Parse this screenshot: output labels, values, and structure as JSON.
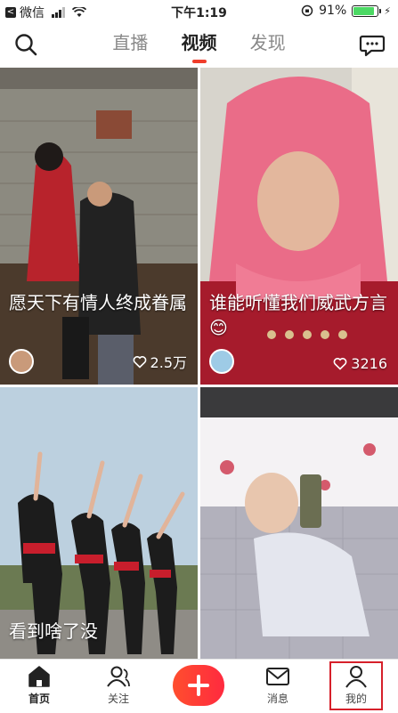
{
  "status_bar": {
    "back_glyph": "<",
    "carrier": "微信",
    "time": "下午1:19",
    "battery_percent": "91%",
    "battery_level": 0.91,
    "icons": [
      "signal-icon",
      "wifi-icon",
      "orientation-lock-icon",
      "battery-icon",
      "charging-icon"
    ]
  },
  "top_nav": {
    "tabs": [
      {
        "label": "直播",
        "active": false
      },
      {
        "label": "视频",
        "active": true
      },
      {
        "label": "发现",
        "active": false
      }
    ],
    "icons": [
      "search-icon",
      "chat-icon"
    ],
    "accent_color": "#f03e2c"
  },
  "feed": {
    "cards": [
      {
        "caption": "愿天下有情人终成眷属",
        "likes": "2.5万",
        "icons": [
          "avatar",
          "heart-icon"
        ]
      },
      {
        "caption": "谁能听懂我们威武方言😊",
        "likes": "3216",
        "icons": [
          "avatar",
          "heart-icon"
        ]
      },
      {
        "caption": "看到啥了没"
      },
      {
        "caption": ""
      }
    ]
  },
  "bottom_nav": {
    "items": [
      {
        "label": "首页",
        "icon": "home-icon",
        "active": true
      },
      {
        "label": "关注",
        "icon": "follow-icon",
        "active": false
      },
      {
        "label": "",
        "icon": "plus-icon",
        "active": false
      },
      {
        "label": "消息",
        "icon": "message-icon",
        "active": false
      },
      {
        "label": "我的",
        "icon": "profile-icon",
        "active": false
      }
    ],
    "plus_color": "#ff3b30",
    "highlight_color": "#d6202a"
  }
}
